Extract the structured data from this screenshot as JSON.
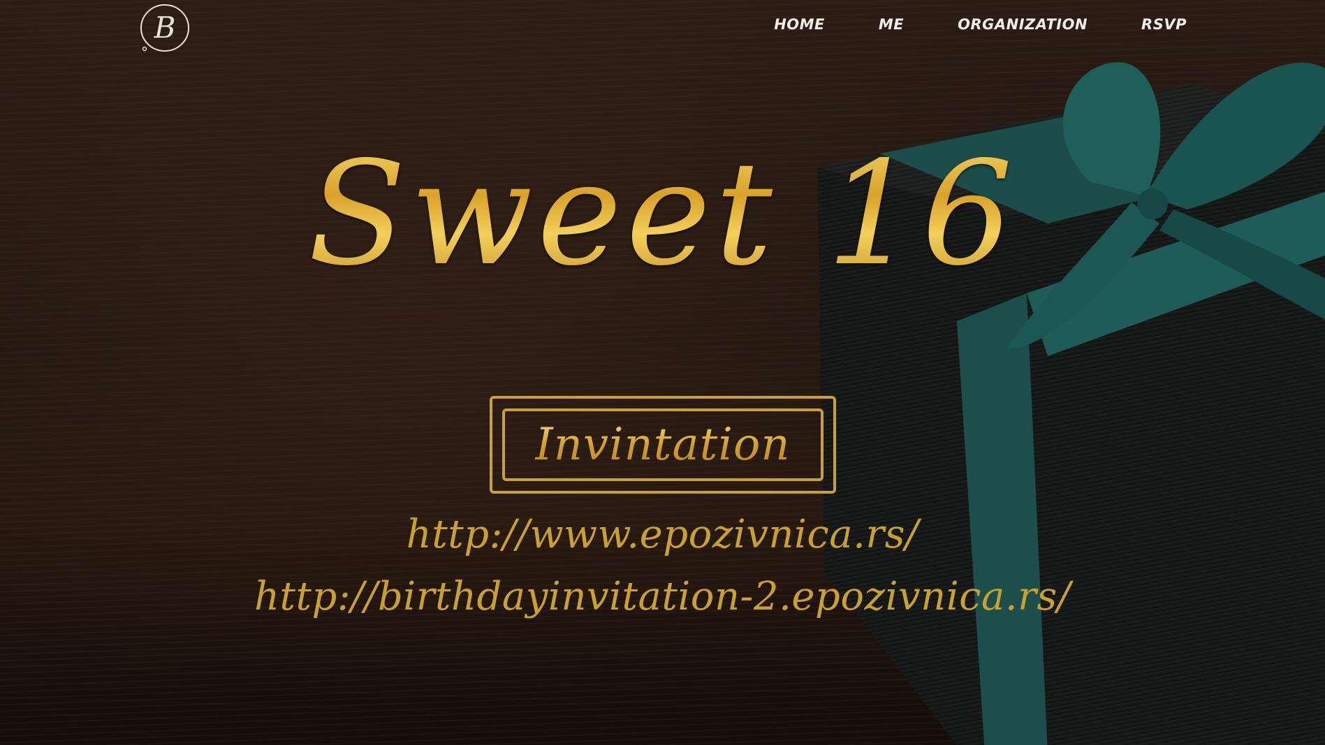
{
  "logo": {
    "letter": "B",
    "icon": "monogram-b-logo"
  },
  "nav": {
    "items": [
      {
        "label": "HOME"
      },
      {
        "label": "ME"
      },
      {
        "label": "ORGANIZATION"
      },
      {
        "label": "RSVP"
      }
    ]
  },
  "hero": {
    "title": "Sweet 16",
    "button_label": "Invintation",
    "links": [
      "http://www.epozivnica.rs/",
      "http://birthdayinvitation-2.epozivnica.rs/"
    ]
  },
  "colors": {
    "gold": "#c9a130",
    "nav_text": "#f2ece4",
    "background": "#1e140e",
    "ribbon": "#1e5c58"
  }
}
